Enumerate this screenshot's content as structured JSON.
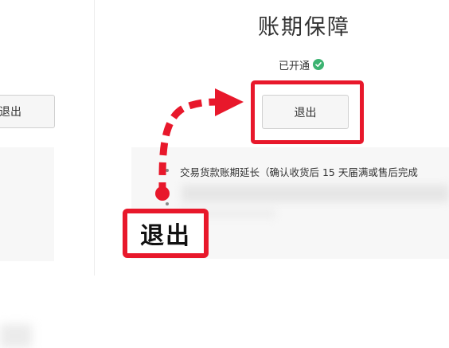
{
  "left_panel": {
    "exit_button_label": "退出"
  },
  "main": {
    "title": "账期保障",
    "status_text": "已开通",
    "exit_button_label": "退出",
    "info_text": "交易货款账期延长（确认收货后 15 天届满或售后完成"
  },
  "annotation": {
    "callout_label": "退出",
    "accent_color": "#e8182b"
  },
  "icons": {
    "status": "check-circle-icon"
  },
  "colors": {
    "status_green": "#3cb371",
    "button_bg": "#f6f6f6"
  }
}
